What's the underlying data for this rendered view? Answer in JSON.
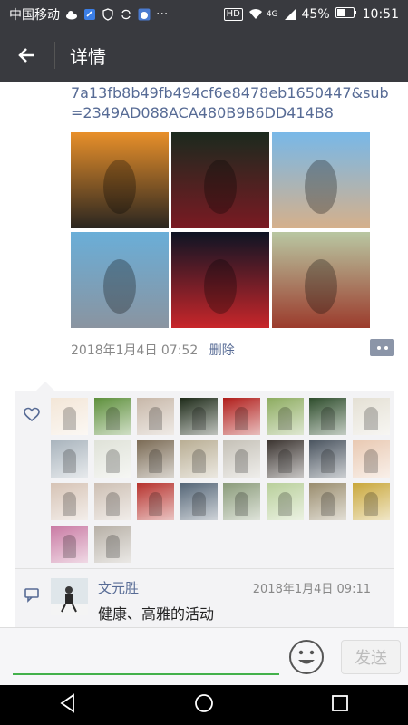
{
  "status_bar": {
    "carrier": "中国移动",
    "notification_icons": [
      "cloud-icon",
      "app-icon",
      "shield-icon",
      "sync-icon",
      "cat-app-icon",
      "more-dots-icon"
    ],
    "hd_label": "HD",
    "network": "4G",
    "battery": "45%",
    "time": "10:51"
  },
  "app_bar": {
    "title": "详情"
  },
  "post": {
    "link_text": "7a13fb8b49fb494cf6e8478eb1650447&sub=2349AD088ACA480B9B6DD414B8",
    "photos": [
      {
        "label": "heron-sunset-photo",
        "colors": [
          "#e8902a",
          "#2a2620"
        ]
      },
      {
        "label": "soccer-player-photo",
        "colors": [
          "#1b2a1e",
          "#7a1a23"
        ]
      },
      {
        "label": "runners-photo",
        "colors": [
          "#78b8e8",
          "#d5b08b"
        ]
      },
      {
        "label": "opera-house-photo",
        "colors": [
          "#6aaed8",
          "#8a94a0"
        ]
      },
      {
        "label": "soccer-celebration-photo",
        "colors": [
          "#0d1424",
          "#c8262a"
        ]
      },
      {
        "label": "cyclists-photo",
        "colors": [
          "#b9c7a2",
          "#9b3b2c"
        ]
      }
    ],
    "timestamp": "2018年1月4日 07:52",
    "delete_label": "删除"
  },
  "likes": {
    "avatars": [
      {
        "name": "avatar-seal",
        "color": "#f3e6d7"
      },
      {
        "name": "avatar-flowers",
        "color": "#5d8f3b"
      },
      {
        "name": "avatar-kitten",
        "color": "#c7b7a8"
      },
      {
        "name": "avatar-lotus",
        "color": "#1e2b19"
      },
      {
        "name": "avatar-red-flower",
        "color": "#b01d1a"
      },
      {
        "name": "avatar-field",
        "color": "#8cab5f"
      },
      {
        "name": "avatar-bird",
        "color": "#2e4d2c"
      },
      {
        "name": "avatar-dancer",
        "color": "#e4e0d4"
      },
      {
        "name": "avatar-city",
        "color": "#a9b4bd"
      },
      {
        "name": "avatar-bonsai",
        "color": "#dfe2d8"
      },
      {
        "name": "avatar-mountain",
        "color": "#7b6b55"
      },
      {
        "name": "avatar-stones",
        "color": "#b9ae94"
      },
      {
        "name": "avatar-woman-red",
        "color": "#c5c1b7"
      },
      {
        "name": "avatar-horse",
        "color": "#3b3430"
      },
      {
        "name": "avatar-man-suit",
        "color": "#4b5560"
      },
      {
        "name": "avatar-fox",
        "color": "#e9c9b2"
      },
      {
        "name": "avatar-girl",
        "color": "#d6c3b5"
      },
      {
        "name": "avatar-woman",
        "color": "#cdbfb3"
      },
      {
        "name": "avatar-man-red",
        "color": "#b6322d"
      },
      {
        "name": "avatar-taichi",
        "color": "#556677"
      },
      {
        "name": "avatar-park",
        "color": "#8a9b7a"
      },
      {
        "name": "avatar-woman-field",
        "color": "#b8cf9a"
      },
      {
        "name": "avatar-couple",
        "color": "#9a8d6e"
      },
      {
        "name": "avatar-yellow",
        "color": "#c9a73b"
      },
      {
        "name": "avatar-lady-purple",
        "color": "#c97aa3"
      },
      {
        "name": "avatar-elder",
        "color": "#b7b0a6"
      }
    ]
  },
  "comment": {
    "author": "文元胜",
    "time": "2018年1月4日 09:11",
    "text": "健康、高雅的活动"
  },
  "input_bar": {
    "send_label": "发送"
  },
  "nav_bar": {
    "buttons": [
      "back",
      "home",
      "recents"
    ]
  }
}
